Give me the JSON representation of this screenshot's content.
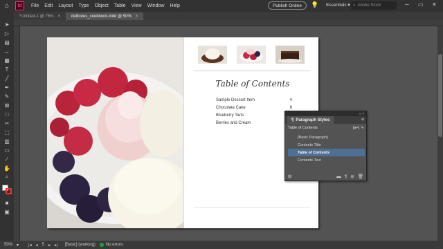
{
  "app": {
    "logo": "Id",
    "menu": [
      "File",
      "Edit",
      "Layout",
      "Type",
      "Object",
      "Table",
      "View",
      "Window",
      "Help"
    ]
  },
  "header": {
    "publish_label": "Publish Online",
    "workspace": "Essentials",
    "stock_placeholder": "Adobe Stock"
  },
  "tabs": [
    {
      "label": "*Untitled-1 @ 75%"
    },
    {
      "label": "delicious_cookbook.indd @ 50%"
    }
  ],
  "document": {
    "toc_title": "Table of Contents",
    "toc_entries": [
      {
        "title": "Sample Dessert Item",
        "page": "4"
      },
      {
        "title": "Chocolate Cake",
        "page": "6"
      },
      {
        "title": "Blueberry Tarts",
        "page": ""
      },
      {
        "title": "Berries and Cream",
        "page": ""
      }
    ]
  },
  "panel": {
    "title": "Paragraph Styles",
    "current_style": "Table of Contents",
    "styles": [
      "[Basic Paragraph]",
      "Contents Title",
      "Table of Contents",
      "Contents Text"
    ],
    "selected_index": 2
  },
  "status": {
    "zoom": "50%",
    "page": "5",
    "master": "[Basic] (working)",
    "preflight": "No errors"
  },
  "colors": {
    "accent": "#4e6f96",
    "preflight_ok": "#1aa33b"
  }
}
